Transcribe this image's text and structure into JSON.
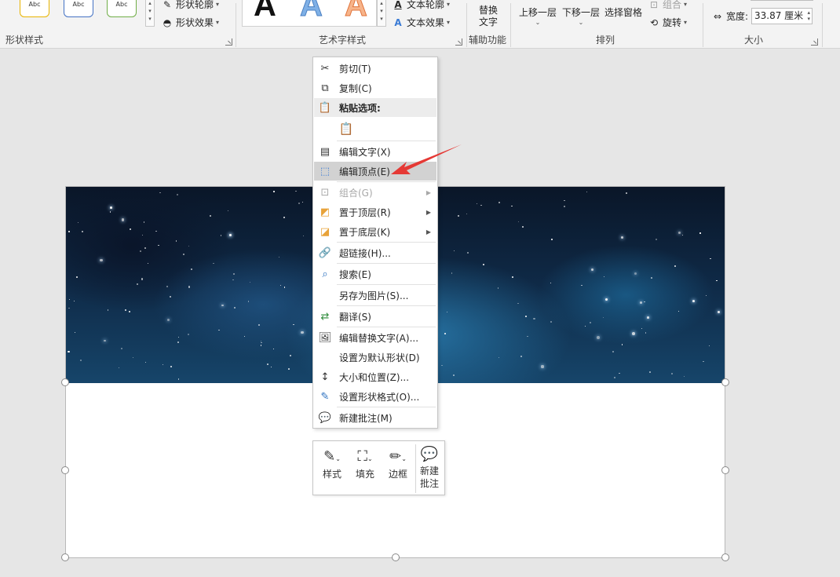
{
  "ribbon": {
    "shape_styles": {
      "label": "形状样式",
      "presets": [
        "Abc",
        "Abc",
        "Abc"
      ],
      "outline": "形状轮廓",
      "effects": "形状效果"
    },
    "wordart": {
      "label": "艺术字样式",
      "letters": [
        "A",
        "A",
        "A"
      ],
      "text_outline": "文本轮廓",
      "text_effects": "文本效果"
    },
    "accessibility": {
      "label": "辅助功能",
      "alt_text_line1": "替换",
      "alt_text_line2": "文字"
    },
    "arrange": {
      "label": "排列",
      "bring_forward": "上移一层",
      "send_backward": "下移一层",
      "selection_pane": "选择窗格",
      "group": "组合",
      "rotate": "旋转"
    },
    "size": {
      "label": "大小",
      "width_label": "宽度:",
      "width_value": "33.87 厘米"
    }
  },
  "context_menu": {
    "items": [
      {
        "label": "剪切(T)",
        "icon": "scissors-icon"
      },
      {
        "label": "复制(C)",
        "icon": "copy-icon"
      },
      {
        "label": "粘贴选项:",
        "icon": "paste-icon"
      },
      {
        "label": "编辑文字(X)",
        "icon": "text-box-icon"
      },
      {
        "label": "编辑顶点(E)",
        "icon": "edit-points-icon"
      },
      {
        "label": "组合(G)",
        "icon": "group-icon"
      },
      {
        "label": "置于顶层(R)",
        "icon": "bring-to-front-icon"
      },
      {
        "label": "置于底层(K)",
        "icon": "send-to-back-icon"
      },
      {
        "label": "超链接(H)...",
        "icon": "link-icon"
      },
      {
        "label": "搜索(E)",
        "icon": "search-icon"
      },
      {
        "label": "另存为图片(S)...",
        "icon": ""
      },
      {
        "label": "翻译(S)",
        "icon": "translate-icon"
      },
      {
        "label": "编辑替换文字(A)...",
        "icon": "alt-text-icon"
      },
      {
        "label": "设置为默认形状(D)",
        "icon": ""
      },
      {
        "label": "大小和位置(Z)...",
        "icon": "size-position-icon"
      },
      {
        "label": "设置形状格式(O)...",
        "icon": "format-shape-icon"
      },
      {
        "label": "新建批注(M)",
        "icon": "new-comment-icon"
      }
    ],
    "highlighted": "编辑顶点(E)"
  },
  "mini_toolbar": {
    "style": "样式",
    "fill": "填充",
    "border": "边框",
    "new_comment_line1": "新建",
    "new_comment_line2": "批注"
  },
  "colors": {
    "annotation_arrow": "#e53935",
    "menu_highlight": "#d2d2d2",
    "galaxy_dark": "#0a1628",
    "galaxy_light": "#16456a"
  }
}
